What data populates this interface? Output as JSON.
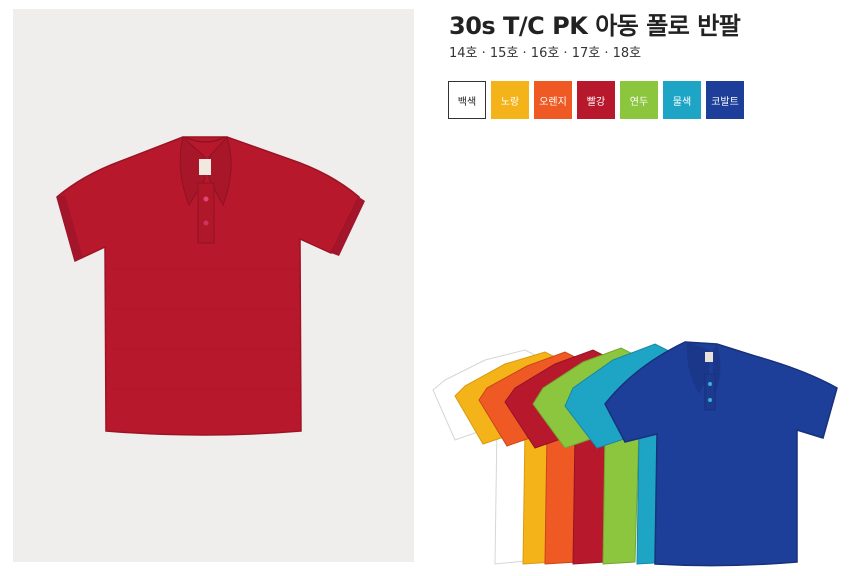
{
  "product": {
    "title": "30s T/C PK 아동 폴로 반팔",
    "sizes": "14호 · 15호 · 16호 · 17호 · 18호"
  },
  "main_image": {
    "color": "#b8182c",
    "background": "#efeeec"
  },
  "colors": [
    {
      "label": "백색",
      "hex": "#ffffff"
    },
    {
      "label": "노랑",
      "hex": "#f4b319"
    },
    {
      "label": "오렌지",
      "hex": "#ef5a24"
    },
    {
      "label": "빨강",
      "hex": "#b8182c"
    },
    {
      "label": "연두",
      "hex": "#8cc63f"
    },
    {
      "label": "물색",
      "hex": "#1ea5c6"
    },
    {
      "label": "코발트",
      "hex": "#1e3f99"
    }
  ]
}
